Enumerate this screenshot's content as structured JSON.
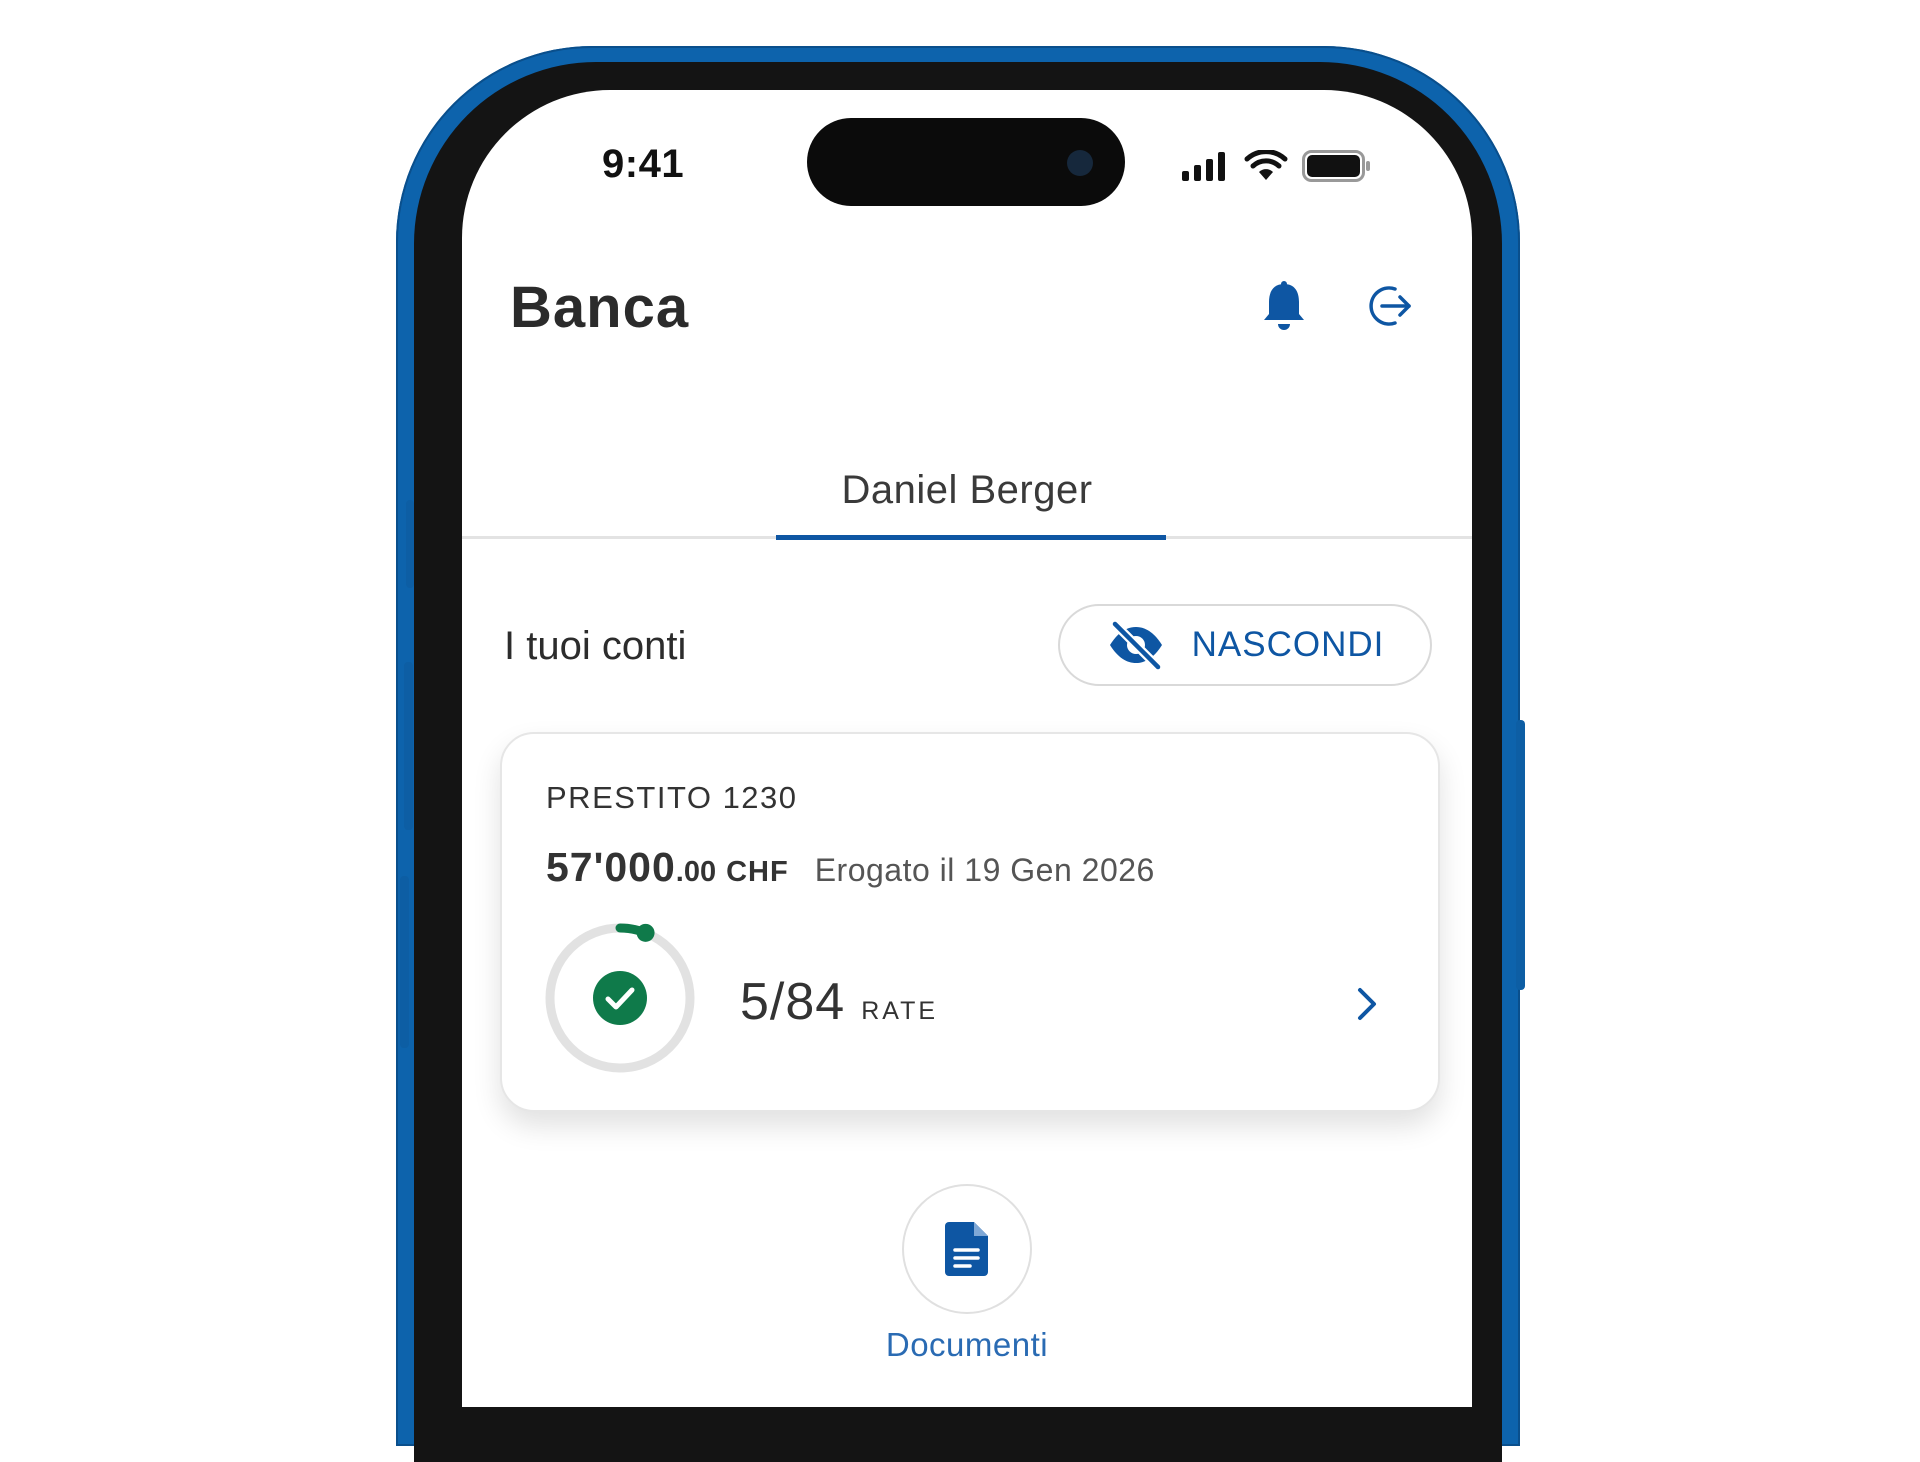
{
  "status_bar": {
    "time": "9:41"
  },
  "header": {
    "brand": "Banca",
    "icons": [
      "bell-icon",
      "logout-icon"
    ]
  },
  "tabs": [
    {
      "label": "Daniel Berger",
      "active": true
    }
  ],
  "accounts": {
    "section_title": "I tuoi conti",
    "hide_button_label": "NASCONDI"
  },
  "loan_card": {
    "title": "PRESTITO 1230",
    "amount_integer": "57'000",
    "amount_decimal": ".00",
    "currency": "CHF",
    "disbursed": "Erogato il 19 Gen 2026",
    "installments_paid": 5,
    "installments_total": 84,
    "installments_text": "5/84",
    "installments_unit": "RATE"
  },
  "quick_actions": [
    {
      "label": "Documenti",
      "icon": "document-icon"
    }
  ],
  "colors": {
    "accent": "#0e56a3",
    "progress": "#0f7a4a",
    "phone_frame": "#0d63ac",
    "text_dark": "#2b2b2b"
  }
}
